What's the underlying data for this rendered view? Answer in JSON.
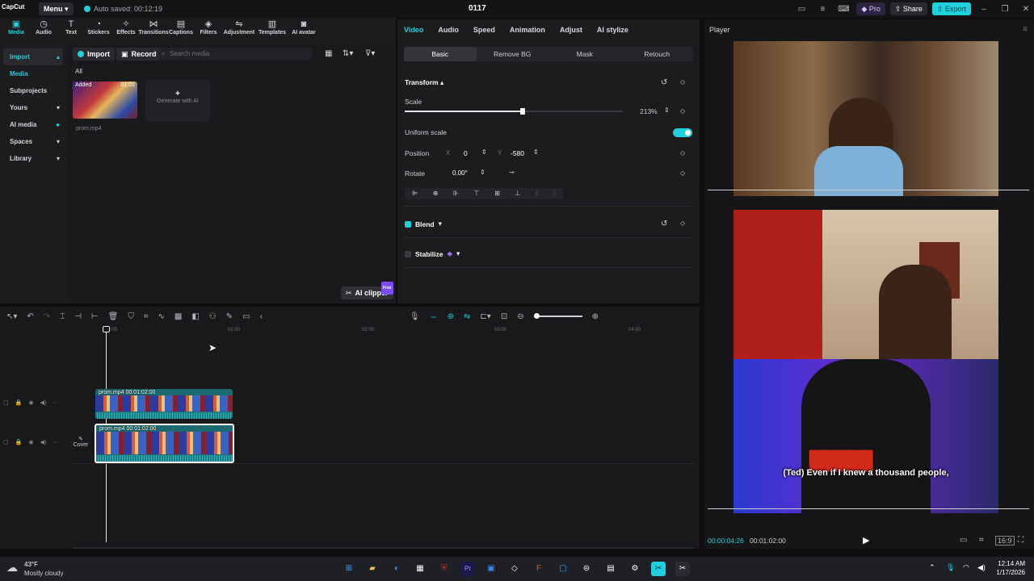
{
  "app": {
    "logo": "CapCut",
    "menu_label": "Menu",
    "autosave": "Auto saved: 00:12:19",
    "project_title": "0117",
    "pro_label": "Pro",
    "share_label": "Share",
    "export_label": "Export"
  },
  "toolbar": {
    "items": [
      {
        "label": "Media",
        "icon": "media-icon"
      },
      {
        "label": "Audio",
        "icon": "audio-icon"
      },
      {
        "label": "Text",
        "icon": "text-icon"
      },
      {
        "label": "Stickers",
        "icon": "stickers-icon"
      },
      {
        "label": "Effects",
        "icon": "effects-icon"
      },
      {
        "label": "Transitions",
        "icon": "transitions-icon"
      },
      {
        "label": "Captions",
        "icon": "captions-icon"
      },
      {
        "label": "Filters",
        "icon": "filters-icon"
      },
      {
        "label": "Adjustment",
        "icon": "adjustment-icon"
      },
      {
        "label": "Templates",
        "icon": "templates-icon"
      },
      {
        "label": "AI avatar",
        "icon": "ai-avatar-icon"
      }
    ]
  },
  "sidenav": {
    "items": [
      {
        "label": "Import"
      },
      {
        "label": "Media"
      },
      {
        "label": "Subprojects"
      },
      {
        "label": "Yours"
      },
      {
        "label": "AI media"
      },
      {
        "label": "Spaces"
      },
      {
        "label": "Library"
      }
    ]
  },
  "media": {
    "import_label": "Import",
    "record_label": "Record",
    "search_placeholder": "Search media",
    "filter_all": "All",
    "thumb_tag": "Added",
    "thumb_duration": "01:02",
    "thumb_filename": "prom.mp4",
    "generate_label": "Generate with AI",
    "ai_clipper_label": "AI clipper",
    "ai_clipper_badge": "Free"
  },
  "properties": {
    "tabs": [
      "Video",
      "Audio",
      "Speed",
      "Animation",
      "Adjust",
      "AI stylize"
    ],
    "subtabs": [
      "Basic",
      "Remove BG",
      "Mask",
      "Retouch"
    ],
    "transform_label": "Transform",
    "scale_label": "Scale",
    "scale_value": "213%",
    "scale_fraction": 0.54,
    "uniform_scale_label": "Uniform scale",
    "position_label": "Position",
    "position_x_label": "X",
    "position_x": "0",
    "position_y_label": "Y",
    "position_y": "-580",
    "rotate_label": "Rotate",
    "rotate_value": "0.00°",
    "blend_label": "Blend",
    "stabilize_label": "Stabilize"
  },
  "player": {
    "label": "Player",
    "subtitle": "(Ted)  Even if I knew a thousand people,",
    "current_time": "00:00:04:26",
    "total_time": "00:01:02:00",
    "ratio_label": "Ratio"
  },
  "timeline": {
    "ruler_labels": [
      "00:00",
      "01:00",
      "02:00",
      "03:00",
      "04:00"
    ],
    "clip1_name": "prom.mp4",
    "clip1_duration": "00:01:02:00",
    "clip2_name": "prom.mp4",
    "clip2_duration": "00:01:02:00",
    "cover_label": "Cover"
  },
  "taskbar": {
    "temperature": "43°F",
    "weather": "Mostly cloudy",
    "time": "12:14 AM",
    "date": "1/17/2026"
  }
}
